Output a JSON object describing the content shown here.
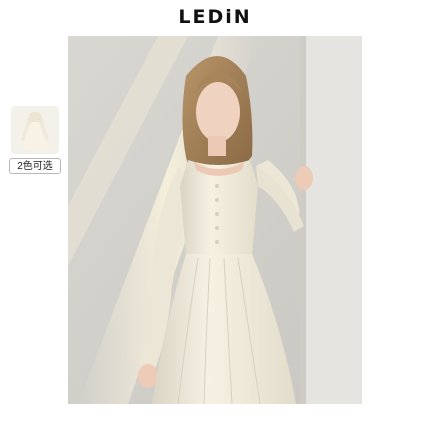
{
  "brand": {
    "logo_text": "LEDiN"
  },
  "thumbnail": {
    "badge_label": "2色可选"
  },
  "photo": {
    "subject": "product-photo-model-in-cream-dress"
  },
  "colors": {
    "background": "#ffffff",
    "text": "#111111",
    "dress": "#f3eee0",
    "wall": "#e3e0da"
  }
}
